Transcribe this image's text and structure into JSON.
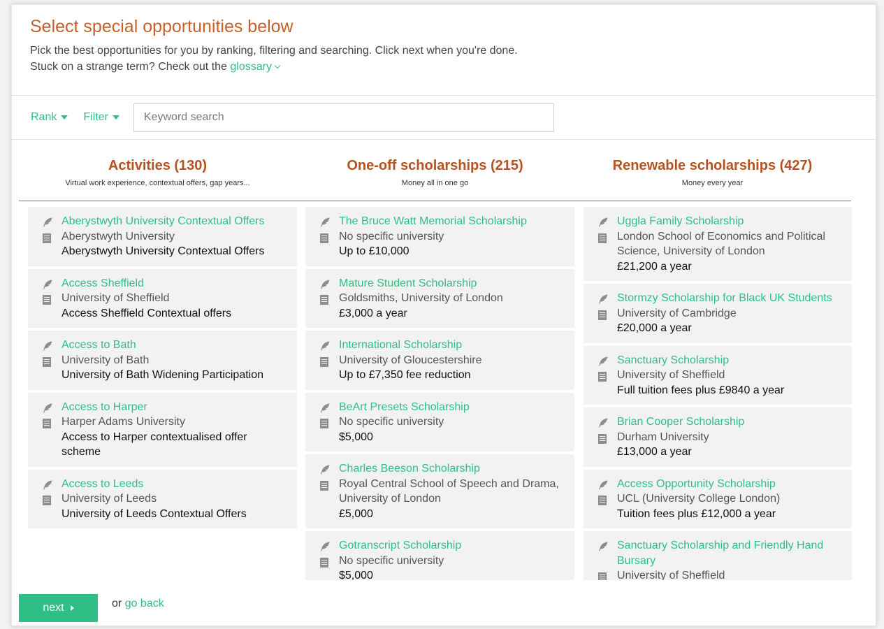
{
  "intro": {
    "heading": "Select special opportunities below",
    "line1": "Pick the best opportunities for you by ranking, filtering and searching. Click next when you're done.",
    "line2_prefix": "Stuck on a strange term? Check out the",
    "glossary_link": "glossary"
  },
  "toolbar": {
    "rank_label": "Rank",
    "filter_label": "Filter",
    "search_placeholder": "Keyword search"
  },
  "columns": [
    {
      "title": "Activities (130)",
      "subtitle": "Virtual work experience, contextual offers, gap years...",
      "cards": [
        {
          "title": "Aberystwyth University Contextual Offers",
          "university": "Aberystwyth University",
          "value": "Aberystwyth University Contextual Offers"
        },
        {
          "title": "Access Sheffield",
          "university": "University of Sheffield",
          "value": "Access Sheffield Contextual offers"
        },
        {
          "title": "Access to Bath",
          "university": "University of Bath",
          "value": "University of Bath Widening Participation"
        },
        {
          "title": "Access to Harper",
          "university": "Harper Adams University",
          "value": "Access to Harper contextualised offer scheme"
        },
        {
          "title": "Access to Leeds",
          "university": "University of Leeds",
          "value": "University of Leeds Contextual Offers"
        }
      ]
    },
    {
      "title": "One-off scholarships (215)",
      "subtitle": "Money all in one go",
      "cards": [
        {
          "title": "The Bruce Watt Memorial Scholarship",
          "university": "No specific university",
          "value": "Up to £10,000"
        },
        {
          "title": "Mature Student Scholarship",
          "university": "Goldsmiths, University of London",
          "value": "£3,000 a year"
        },
        {
          "title": "International Scholarship",
          "university": "University of Gloucestershire",
          "value": "Up to £7,350 fee reduction"
        },
        {
          "title": "BeArt Presets Scholarship",
          "university": "No specific university",
          "value": "$5,000"
        },
        {
          "title": "Charles Beeson Scholarship",
          "university": "Royal Central School of Speech and Drama, University of London",
          "value": "£5,000"
        },
        {
          "title": "Gotranscript Scholarship",
          "university": "No specific university",
          "value": "$5,000"
        }
      ]
    },
    {
      "title": "Renewable scholarships (427)",
      "subtitle": "Money every year",
      "cards": [
        {
          "title": "Uggla Family Scholarship",
          "university": "London School of Economics and Political Science, University of London",
          "value": "£21,200 a year"
        },
        {
          "title": "Stormzy Scholarship for Black UK Students",
          "university": "University of Cambridge",
          "value": "£20,000 a year"
        },
        {
          "title": "Sanctuary Scholarship",
          "university": "University of Sheffield",
          "value": "Full tuition fees plus £9840 a year"
        },
        {
          "title": "Brian Cooper Scholarship",
          "university": "Durham University",
          "value": "£13,000 a year"
        },
        {
          "title": "Access Opportunity Scholarship",
          "university": "UCL (University College London)",
          "value": "Tuition fees plus £12,000 a year"
        },
        {
          "title": "Sanctuary Scholarship and Friendly Hand Bursary",
          "university": "University of Sheffield",
          "value": ""
        }
      ]
    }
  ],
  "footer": {
    "next_label": "next",
    "or_text": "or",
    "back_link": "go back"
  },
  "colors": {
    "accent": "#2fbf86",
    "heading": "#c8602a",
    "column_title": "#b5521f",
    "card_bg": "#f2f2f2"
  },
  "icons": {
    "title": "feather-icon",
    "university": "building-icon"
  }
}
